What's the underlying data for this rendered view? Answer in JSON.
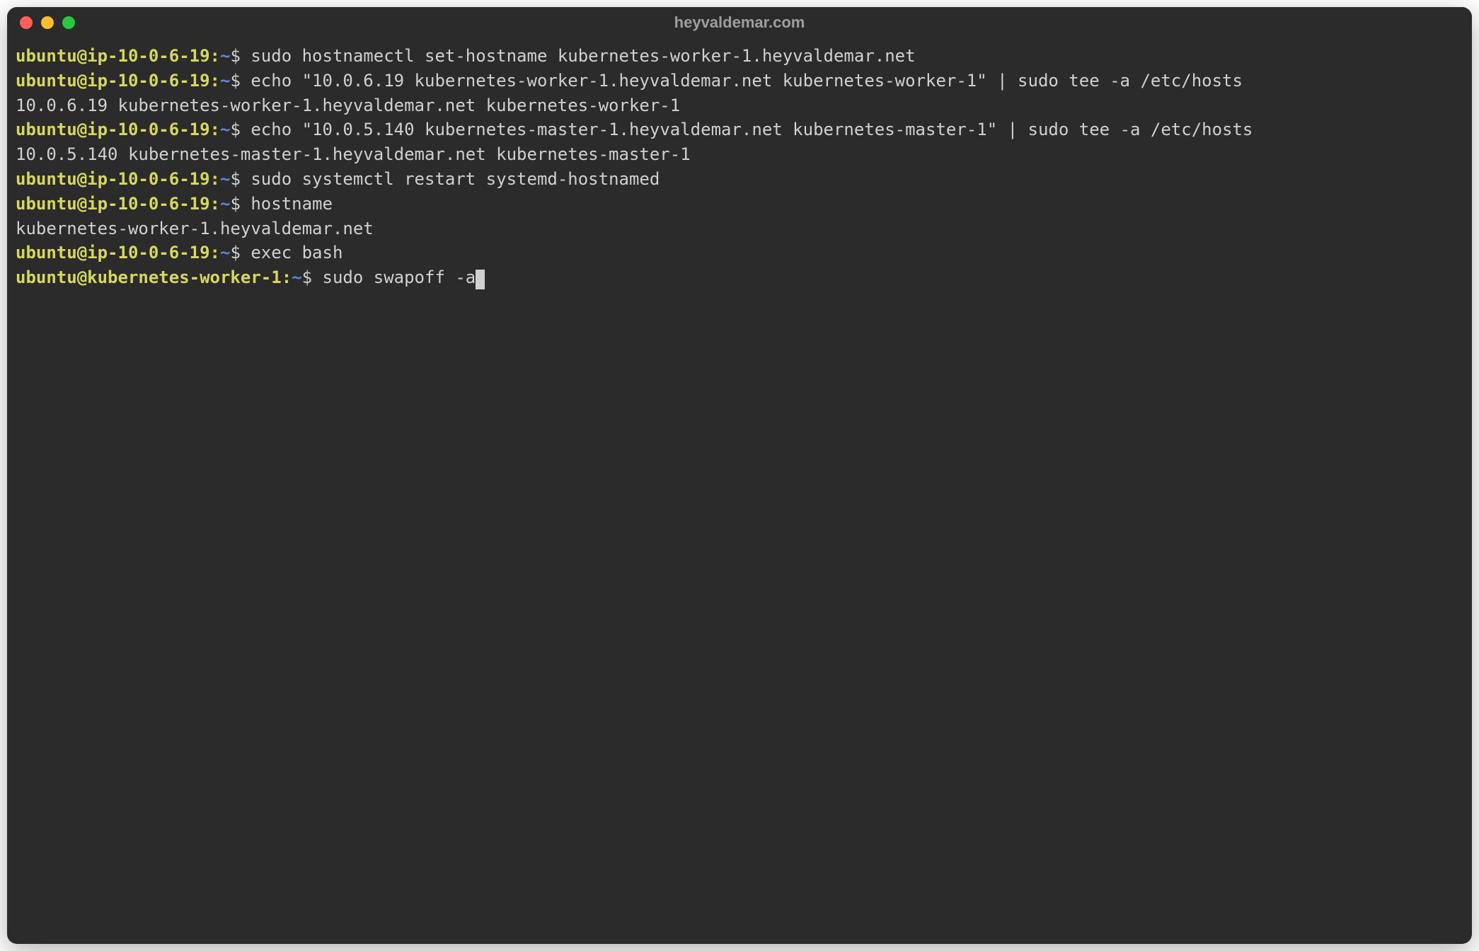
{
  "window": {
    "title": "heyvaldemar.com"
  },
  "lines": [
    {
      "type": "prompt",
      "user_host": "ubuntu@ip-10-0-6-19",
      "path": "~",
      "command": "sudo hostnamectl set-hostname kubernetes-worker-1.heyvaldemar.net"
    },
    {
      "type": "prompt",
      "user_host": "ubuntu@ip-10-0-6-19",
      "path": "~",
      "command": "echo \"10.0.6.19 kubernetes-worker-1.heyvaldemar.net kubernetes-worker-1\" | sudo tee -a /etc/hosts"
    },
    {
      "type": "output",
      "text": "10.0.6.19 kubernetes-worker-1.heyvaldemar.net kubernetes-worker-1"
    },
    {
      "type": "prompt",
      "user_host": "ubuntu@ip-10-0-6-19",
      "path": "~",
      "command": "echo \"10.0.5.140 kubernetes-master-1.heyvaldemar.net kubernetes-master-1\" | sudo tee -a /etc/hosts"
    },
    {
      "type": "output",
      "text": "10.0.5.140 kubernetes-master-1.heyvaldemar.net kubernetes-master-1"
    },
    {
      "type": "prompt",
      "user_host": "ubuntu@ip-10-0-6-19",
      "path": "~",
      "command": "sudo systemctl restart systemd-hostnamed"
    },
    {
      "type": "prompt",
      "user_host": "ubuntu@ip-10-0-6-19",
      "path": "~",
      "command": "hostname"
    },
    {
      "type": "output",
      "text": "kubernetes-worker-1.heyvaldemar.net"
    },
    {
      "type": "prompt",
      "user_host": "ubuntu@ip-10-0-6-19",
      "path": "~",
      "command": "exec bash"
    },
    {
      "type": "prompt",
      "user_host": "ubuntu@kubernetes-worker-1",
      "path": "~",
      "command": "sudo swapoff -a",
      "cursor": true
    }
  ]
}
